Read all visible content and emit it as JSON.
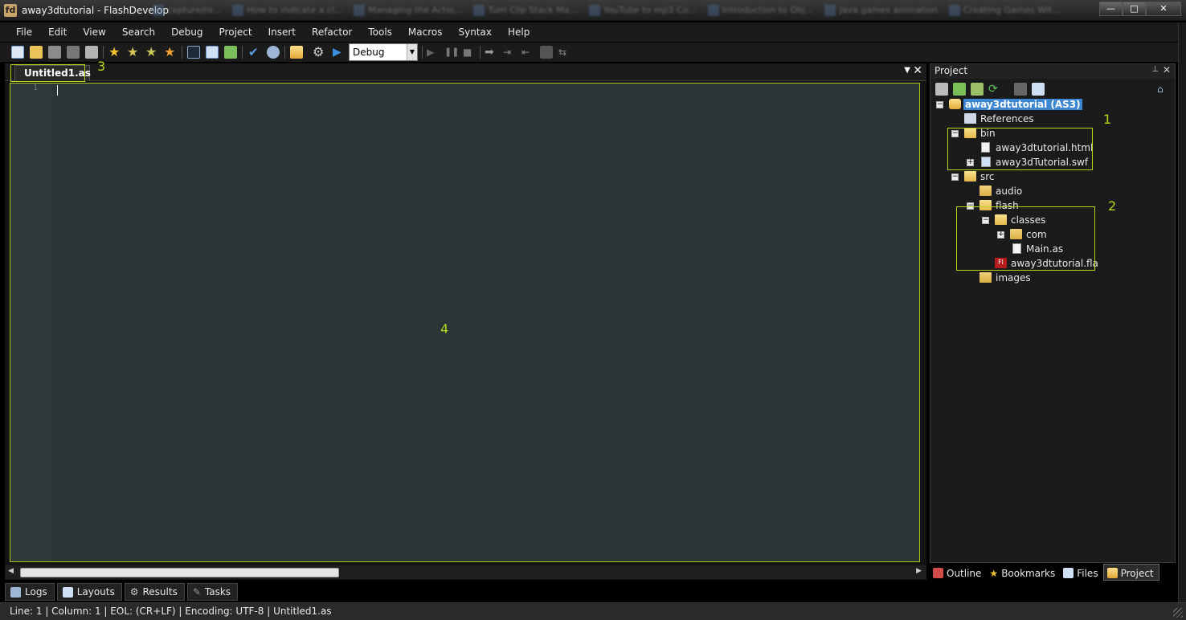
{
  "window": {
    "title": "away3dtutorial - FlashDevelop",
    "background_tabs": [
      "capture/ro...",
      "How to indicate a cl...",
      "Managing the Actio...",
      "Turn Clip Stack Ma...",
      "YouTube to mp3 Co...",
      "Introduction to Obj...",
      "Java games animation",
      "Creating Games Wit..."
    ],
    "minimize_label": "—",
    "maximize_label": "□",
    "close_label": "✕"
  },
  "menu": [
    "File",
    "Edit",
    "View",
    "Search",
    "Debug",
    "Project",
    "Insert",
    "Refactor",
    "Tools",
    "Macros",
    "Syntax",
    "Help"
  ],
  "toolbar": {
    "build_config": "Debug",
    "icons": [
      "new-file-icon",
      "open-file-icon",
      "save-icon",
      "save-all-icon",
      "print-icon",
      "bookmark-star-icon",
      "bookmark-next-icon",
      "bookmark-prev-icon",
      "bookmark-clear-icon",
      "command-prompt-icon",
      "layout-icon",
      "plugin-icon",
      "check-syntax-icon",
      "settings-debug-icon",
      "project-icon",
      "gear-icon",
      "run-icon",
      "play-icon",
      "pause-icon",
      "stop-icon",
      "step-over-icon",
      "step-into-icon",
      "step-out-icon",
      "continue-icon",
      "finish-icon"
    ]
  },
  "editor": {
    "tab_label": "Untitled1.as",
    "line_number": "1",
    "dropdown_glyph": "▼",
    "close_glyph": "✕"
  },
  "project_panel": {
    "title": "Project",
    "pin_glyph": "⊥",
    "close_glyph": "✕",
    "tree": {
      "root": "away3dtutorial (AS3)",
      "references": "References",
      "bin": "bin",
      "bin_html": "away3dtutorial.html",
      "bin_swf": "away3dTutorial.swf",
      "src": "src",
      "audio": "audio",
      "flash": "flash",
      "classes": "classes",
      "com": "com",
      "main_as": "Main.as",
      "fla": "away3dtutorial.fla",
      "fla_badge": "Fl",
      "images": "images"
    },
    "tabs": [
      "Outline",
      "Bookmarks",
      "Files",
      "Project"
    ]
  },
  "annotations": [
    "1",
    "2",
    "3",
    "4"
  ],
  "output_tabs": [
    "Logs",
    "Layouts",
    "Results",
    "Tasks"
  ],
  "status": {
    "text": "Line: 1  |  Column: 1  |  EOL: (CR+LF)  |  Encoding: UTF-8  |  Untitled1.as"
  },
  "colors": {
    "annotation": "#b8d61e",
    "editor_bg": "#2b3436",
    "selection": "#3d86d4"
  }
}
